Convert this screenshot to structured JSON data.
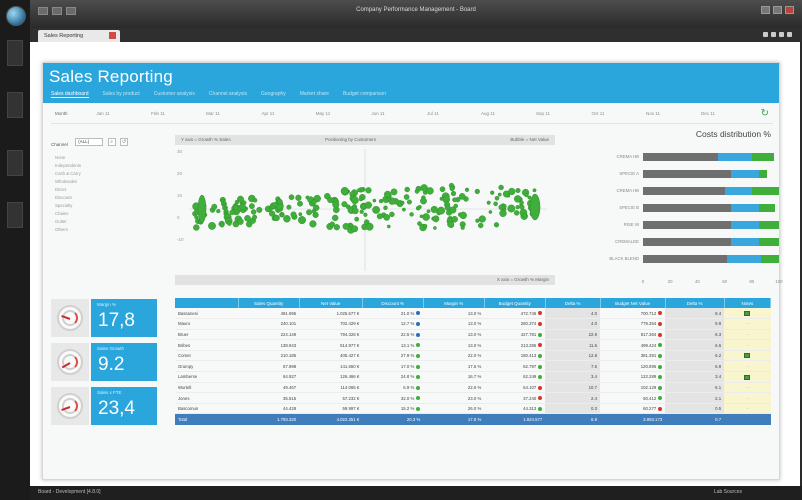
{
  "window": {
    "title": "Company Performance Management - Board"
  },
  "doc_tab": {
    "label": "Sales Reporting"
  },
  "header": {
    "title": "Sales Reporting",
    "nav": [
      "Sales dashboard",
      "Sales by product",
      "Customer analysis",
      "Channel analysis",
      "Geography",
      "Market share",
      "Budget comparison"
    ]
  },
  "period": {
    "label": "Month",
    "months": [
      "Jan 11",
      "Feb 11",
      "Mar 11",
      "Apr 11",
      "May 11",
      "Jun 11",
      "Jul 11",
      "Aug 11",
      "Sep 11",
      "Oct 11",
      "Nov 11",
      "Dec 11"
    ]
  },
  "channel": {
    "label": "Channel",
    "selected": "(ALL)",
    "items": [
      "None",
      "Independents",
      "Cash & Carry",
      "Wholesales",
      "Direct",
      "Discount",
      "Specialty",
      "Chains",
      "Outlet",
      "Others"
    ]
  },
  "scatter": {
    "top_left": "Y axis = Growth % Sales",
    "top_center": "Positioning by Customers",
    "top_right": "Bubble = Net Value",
    "bottom": "X axis = Growth % Margin"
  },
  "kpis": [
    {
      "caption": "Margin %",
      "value": "17,8"
    },
    {
      "caption": "Sales Growth",
      "value": "9.2"
    },
    {
      "caption": "Sales x FTE",
      "value": "23,4"
    }
  ],
  "costs": {
    "title": "Costs distribution %",
    "colors": {
      "grey": "#6f6f6f",
      "blue": "#3aa7dc",
      "green": "#3fae3a"
    },
    "axis_ticks": [
      "0",
      "20",
      "40",
      "60",
      "80",
      "100"
    ]
  },
  "chart_data": {
    "type": "bar",
    "title": "Costs distribution %",
    "categories": [
      "CREMA HB",
      "SPECIE A",
      "CREMA HB",
      "SPECIE B",
      "RISE W",
      "CREMALDE",
      "BLACK BLEND"
    ],
    "series": [],
    "values_grey": [
      55,
      65,
      60,
      65,
      65,
      65,
      62
    ],
    "values_blue": [
      25,
      20,
      20,
      20,
      20,
      20,
      25
    ],
    "values_green": [
      16,
      6,
      20,
      12,
      15,
      15,
      13
    ],
    "xlim": [
      0,
      100
    ]
  },
  "table": {
    "headers": [
      "",
      "Sales Quantity",
      "Net Value",
      "Discount %",
      "Margin %",
      "Budget Quantity",
      "Delta %",
      "Budget Net Value",
      "Delta %",
      "Notes"
    ],
    "rows": [
      {
        "name": "Bassanesi",
        "q": "491.995",
        "nv": "1.025.677 €",
        "disc": "21.0 %",
        "dc": "b",
        "m": "13.0 %",
        "bq": "472.746",
        "bqc": "r",
        "dq": "4.0",
        "bnv": "700.712",
        "bnc": "r",
        "dnv": "8.4",
        "note": "flag"
      },
      {
        "name": "Mauro",
        "q": "240.101",
        "nv": "702.429 €",
        "disc": "12.7 %",
        "dc": "b",
        "m": "13.0 %",
        "bq": "260.374",
        "bqc": "r",
        "dq": "4.0",
        "bnv": "779.354",
        "bnc": "r",
        "dnv": "9.9",
        "note": "dash"
      },
      {
        "name": "Bruer",
        "q": "224.149",
        "nv": "794.328 €",
        "disc": "22.5 %",
        "dc": "b",
        "m": "13.0 %",
        "bq": "427.781",
        "bqc": "g",
        "dq": "22.9",
        "bnv": "817.384",
        "bnc": "r",
        "dnv": "6.3",
        "note": "dash"
      },
      {
        "name": "Bribes",
        "q": "138.943",
        "nv": "514.977 €",
        "disc": "13.1 %",
        "dc": "g",
        "m": "13.0 %",
        "bq": "213.286",
        "bqc": "r",
        "dq": "11.6",
        "bnv": "499.424",
        "bnc": "g",
        "dnv": "6.6",
        "note": "dash"
      },
      {
        "name": "Comet",
        "q": "210.185",
        "nv": "405.427 €",
        "disc": "27.9 %",
        "dc": "g",
        "m": "22.0 %",
        "bq": "180.413",
        "bqc": "g",
        "dq": "12.8",
        "bnv": "381.391",
        "bnc": "g",
        "dnv": "6.2",
        "note": "flag"
      },
      {
        "name": "Grumpy",
        "q": "67.998",
        "nv": "141.650 €",
        "disc": "17.0 %",
        "dc": "g",
        "m": "17.6 %",
        "bq": "62.797",
        "bqc": "g",
        "dq": "7.6",
        "bnv": "120.895",
        "bnc": "g",
        "dnv": "6.9",
        "note": "dash"
      },
      {
        "name": "Lamberse",
        "q": "64.927",
        "nv": "126.466 €",
        "disc": "24.8 %",
        "dc": "g",
        "m": "16.7 %",
        "bq": "62.249",
        "bqc": "g",
        "dq": "3.4",
        "bnv": "122.289",
        "bnc": "g",
        "dnv": "3.4",
        "note": "flag"
      },
      {
        "name": "Wurtell",
        "q": "49.467",
        "nv": "114.065 €",
        "disc": "6.9 %",
        "dc": "g",
        "m": "22.6 %",
        "bq": "54.107",
        "bqc": "r",
        "dq": "10.7",
        "bnv": "102.129",
        "bnc": "g",
        "dnv": "6.1",
        "note": "dash"
      },
      {
        "name": "Jones",
        "q": "35.515",
        "nv": "57.232 €",
        "disc": "32.0 %",
        "dc": "g",
        "m": "23.0 %",
        "bq": "37.240",
        "bqc": "r",
        "dq": "2.4",
        "bnv": "50.412",
        "bnc": "g",
        "dnv": "2.1",
        "note": "dash"
      },
      {
        "name": "Bascomun",
        "q": "44.428",
        "nv": "59.997 €",
        "disc": "15.2 %",
        "dc": "g",
        "m": "26.0 %",
        "bq": "44.313",
        "bqc": "g",
        "dq": "0.3",
        "bnv": "60.277",
        "bnc": "r",
        "dnv": "0.5",
        "note": "dash"
      }
    ],
    "total": {
      "name": "Total",
      "q": "1.793.320",
      "nv": "4.022.351 €",
      "disc": "20.3 %",
      "m": "17.8 %",
      "bq": "1.924.577",
      "dq": "6.9",
      "bnv": "3.993.173",
      "dnv": "0.7"
    }
  },
  "statusbar": {
    "left": "Board - Development [4.8.0]",
    "right": "Lab Sources"
  }
}
